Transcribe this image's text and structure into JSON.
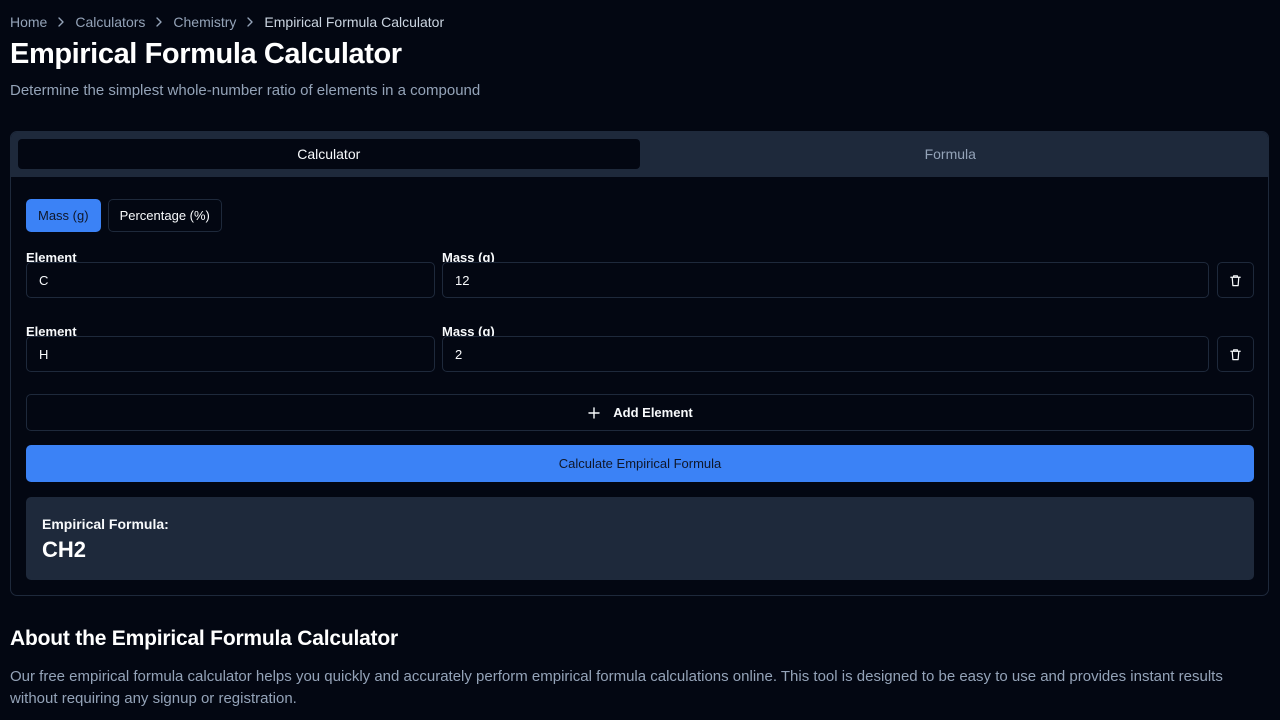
{
  "breadcrumb": [
    "Home",
    "Calculators",
    "Chemistry",
    "Empirical Formula Calculator"
  ],
  "page": {
    "title": "Empirical Formula Calculator",
    "subtitle": "Determine the simplest whole-number ratio of elements in a compound"
  },
  "tabs": [
    {
      "label": "Calculator",
      "active": true
    },
    {
      "label": "Formula",
      "active": false
    }
  ],
  "mode": [
    {
      "label": "Mass (g)",
      "active": true
    },
    {
      "label": "Percentage (%)",
      "active": false
    }
  ],
  "rows": [
    {
      "element_label": "Element",
      "element_value": "C",
      "mass_label": "Mass (g)",
      "mass_value": "12"
    },
    {
      "element_label": "Element",
      "element_value": "H",
      "mass_label": "Mass (g)",
      "mass_value": "2"
    }
  ],
  "actions": {
    "add_label": "Add Element",
    "calculate_label": "Calculate Empirical Formula"
  },
  "result": {
    "label": "Empirical Formula:",
    "value": "CH2"
  },
  "about": {
    "title": "About the Empirical Formula Calculator",
    "text": "Our free empirical formula calculator helps you quickly and accurately perform empirical formula calculations online. This tool is designed to be easy to use and provides instant results without requiring any signup or registration."
  },
  "colors": {
    "background": "#030712",
    "accent": "#3b82f6",
    "panel": "#1e293b",
    "muted_text": "#94a3b8"
  },
  "icons": {
    "breadcrumb_separator": "chevron-right-icon",
    "delete": "trash-icon",
    "add": "plus-icon"
  }
}
